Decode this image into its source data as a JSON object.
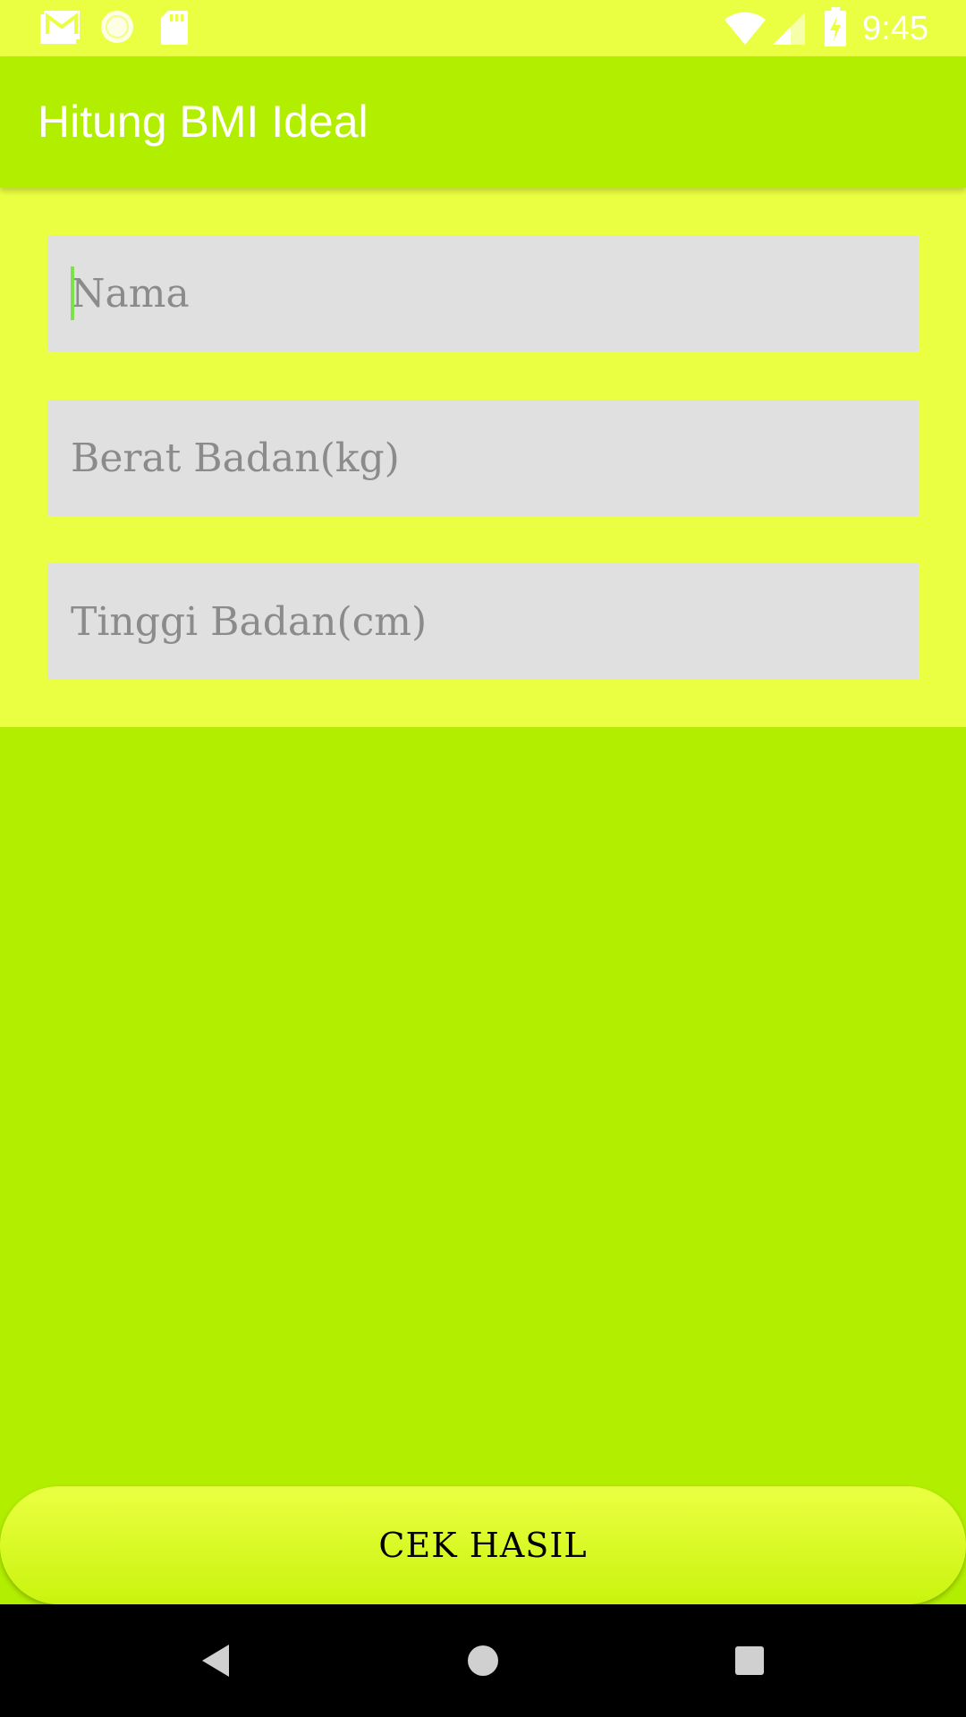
{
  "status_bar": {
    "time": "9:45",
    "icons": [
      "gmail-icon",
      "circle-icon",
      "sd-card-icon",
      "wifi-icon",
      "signal-icon",
      "battery-charging-icon"
    ]
  },
  "app_bar": {
    "title": "Hitung BMI Ideal"
  },
  "form": {
    "nama": {
      "placeholder": "Nama",
      "value": ""
    },
    "berat": {
      "placeholder": "Berat Badan(kg)",
      "value": ""
    },
    "tinggi": {
      "placeholder": "Tinggi Badan(cm)",
      "value": ""
    }
  },
  "button": {
    "label": "CEK HASIL"
  },
  "nav_bar": {
    "icons": [
      "back-icon",
      "home-icon",
      "recents-icon"
    ]
  },
  "colors": {
    "status_bar": "#ebff42",
    "app_bar": "#b2ee00",
    "form_panel": "#ebff42",
    "field_bg": "#e0e0e0",
    "cursor": "#7ee04a",
    "nav_bar": "#000000"
  }
}
